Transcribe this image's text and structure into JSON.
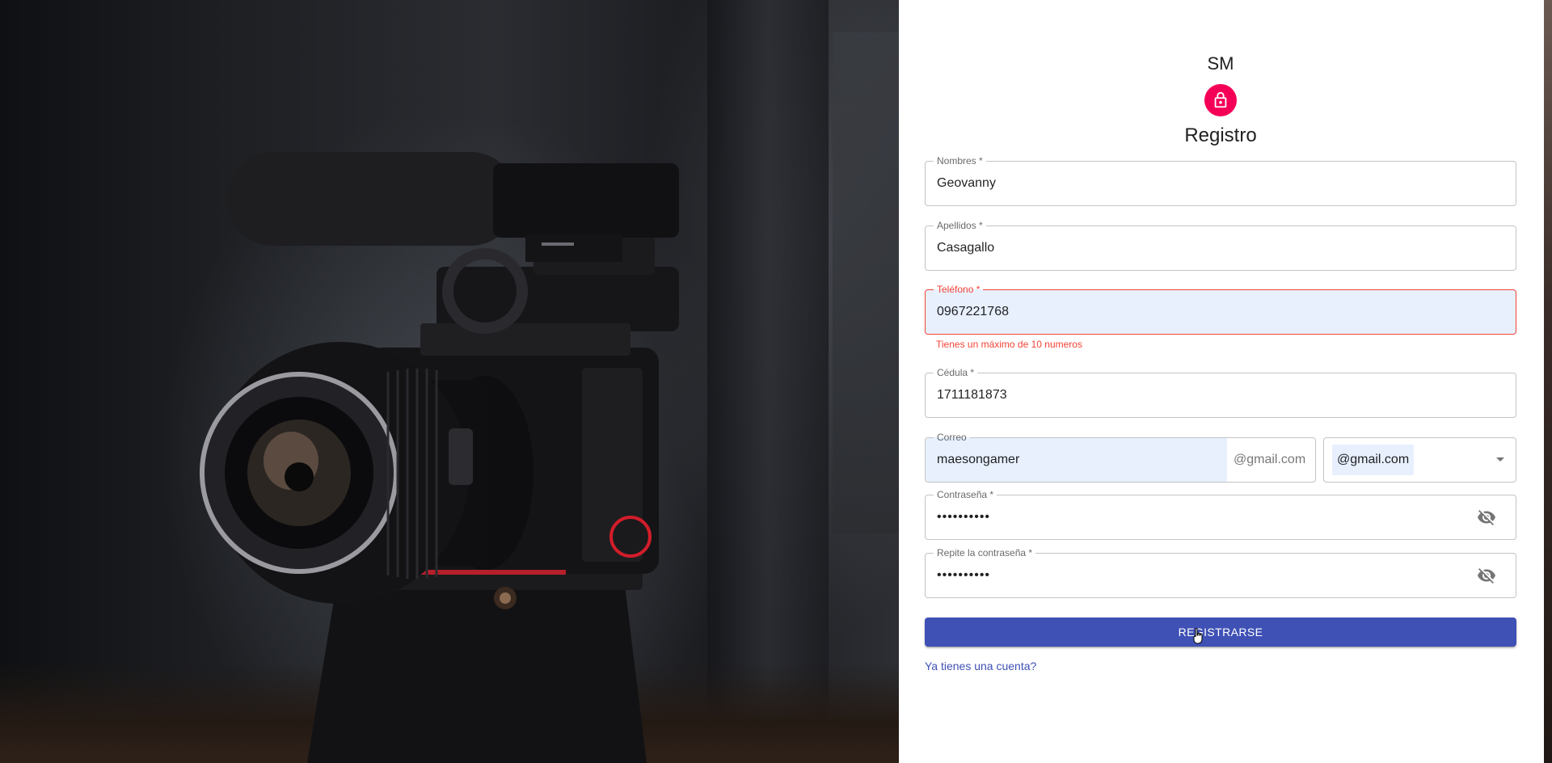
{
  "brand": {
    "text": "SM",
    "accent": "#f50057"
  },
  "form": {
    "title": "Registro",
    "nombres": {
      "label": "Nombres *",
      "value": "Geovanny"
    },
    "apellidos": {
      "label": "Apellidos *",
      "value": "Casagallo"
    },
    "telefono": {
      "label": "Teléfono *",
      "value": "0967221768",
      "error": "Tienes un máximo de 10 numeros"
    },
    "cedula": {
      "label": "Cédula *",
      "value": "1711181873"
    },
    "correo": {
      "label": "Correo",
      "value": "maesongamer",
      "suffix": "@gmail.com",
      "domain_selected": "@gmail.com"
    },
    "contrasena": {
      "label": "Contraseña *",
      "masked": "••••••••••"
    },
    "repite": {
      "label": "Repite la contraseña *",
      "masked": "••••••••••"
    },
    "submit_label": "REGISTRARSE",
    "login_link": "Ya tienes una cuenta?"
  },
  "icons": {
    "lock": "lock-outline-icon",
    "visibility_off": "visibility-off-icon",
    "dropdown": "arrow-drop-down-icon"
  },
  "colors": {
    "primary": "#3f51b5",
    "error": "#f44336",
    "autofill": "#e8f0fe"
  }
}
